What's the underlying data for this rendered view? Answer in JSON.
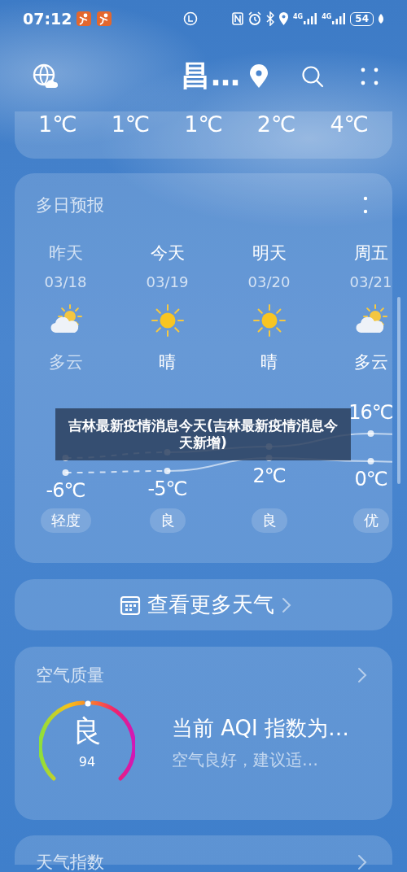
{
  "status_bar": {
    "time": "07:12",
    "signals": [
      "4G",
      "4G"
    ],
    "battery": "54"
  },
  "header": {
    "city": "昌…"
  },
  "hourly": {
    "temps": [
      "1℃",
      "1℃",
      "1℃",
      "2℃",
      "4℃"
    ]
  },
  "forecast": {
    "title": "多日预报",
    "days": [
      {
        "day": "昨天",
        "date": "03/18",
        "kind": "partly_cloudy",
        "weather": "多云",
        "low": "-6℃",
        "aqi": "轻度",
        "past": true
      },
      {
        "day": "今天",
        "date": "03/19",
        "kind": "sunny",
        "weather": "晴",
        "low": "-5℃",
        "aqi": "良",
        "past": false
      },
      {
        "day": "明天",
        "date": "03/20",
        "kind": "sunny",
        "weather": "晴",
        "low": "2℃",
        "aqi": "良",
        "past": false
      },
      {
        "day": "周五",
        "date": "03/21",
        "kind": "partly_cloudy",
        "weather": "多云",
        "high": "16℃",
        "low": "0℃",
        "aqi": "优",
        "past": false
      }
    ]
  },
  "more_button": {
    "label": "查看更多天气"
  },
  "air_quality": {
    "title": "空气质量",
    "grade": "良",
    "value": "94",
    "headline": "当前 AQI 指数为…",
    "advice": "空气良好，建议适…"
  },
  "weather_index": {
    "title": "天气指数"
  },
  "caption": "吉林最新疫情消息今天(吉林最新疫情消息今天新增)"
}
